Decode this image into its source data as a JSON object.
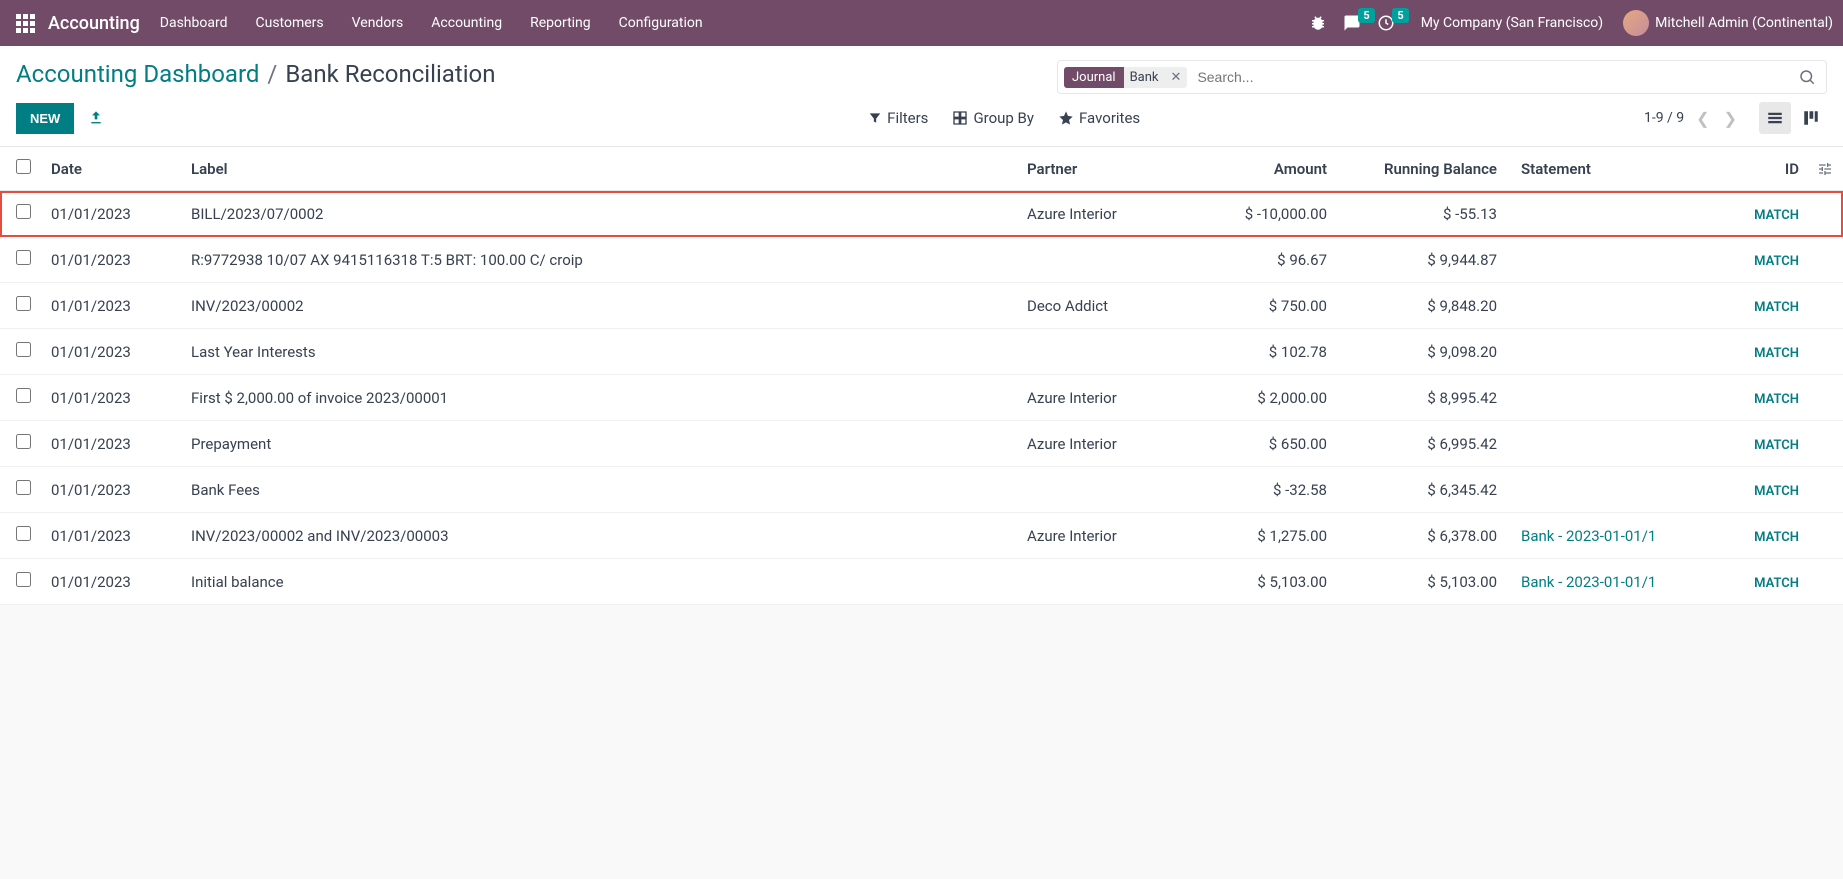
{
  "topbar": {
    "app_name": "Accounting",
    "nav": [
      "Dashboard",
      "Customers",
      "Vendors",
      "Accounting",
      "Reporting",
      "Configuration"
    ],
    "msg_badge": "5",
    "act_badge": "5",
    "company": "My Company (San Francisco)",
    "user": "Mitchell Admin (Continental)"
  },
  "breadcrumb": {
    "root": "Accounting Dashboard",
    "sep": "/",
    "current": "Bank Reconciliation"
  },
  "search": {
    "facet_label": "Journal",
    "facet_value": "Bank",
    "placeholder": "Search..."
  },
  "buttons": {
    "new": "NEW"
  },
  "filters": {
    "filters": "Filters",
    "groupby": "Group By",
    "favorites": "Favorites"
  },
  "pager": {
    "range": "1-9 / 9"
  },
  "columns": {
    "date": "Date",
    "label": "Label",
    "partner": "Partner",
    "amount": "Amount",
    "balance": "Running Balance",
    "statement": "Statement",
    "id": "ID"
  },
  "match_label": "MATCH",
  "rows": [
    {
      "date": "01/01/2023",
      "label": "BILL/2023/07/0002",
      "partner": "Azure Interior",
      "amount": "$ -10,000.00",
      "balance": "$ -55.13",
      "statement": "",
      "highlight": true
    },
    {
      "date": "01/01/2023",
      "label": "R:9772938 10/07 AX 9415116318 T:5 BRT: 100.00 C/ croip",
      "partner": "",
      "amount": "$ 96.67",
      "balance": "$ 9,944.87",
      "statement": ""
    },
    {
      "date": "01/01/2023",
      "label": "INV/2023/00002",
      "partner": "Deco Addict",
      "amount": "$ 750.00",
      "balance": "$ 9,848.20",
      "statement": ""
    },
    {
      "date": "01/01/2023",
      "label": "Last Year Interests",
      "partner": "",
      "amount": "$ 102.78",
      "balance": "$ 9,098.20",
      "statement": ""
    },
    {
      "date": "01/01/2023",
      "label": "First $ 2,000.00 of invoice 2023/00001",
      "partner": "Azure Interior",
      "amount": "$ 2,000.00",
      "balance": "$ 8,995.42",
      "statement": ""
    },
    {
      "date": "01/01/2023",
      "label": "Prepayment",
      "partner": "Azure Interior",
      "amount": "$ 650.00",
      "balance": "$ 6,995.42",
      "statement": ""
    },
    {
      "date": "01/01/2023",
      "label": "Bank Fees",
      "partner": "",
      "amount": "$ -32.58",
      "balance": "$ 6,345.42",
      "statement": ""
    },
    {
      "date": "01/01/2023",
      "label": "INV/2023/00002 and INV/2023/00003",
      "partner": "Azure Interior",
      "amount": "$ 1,275.00",
      "balance": "$ 6,378.00",
      "statement": "Bank - 2023-01-01/1"
    },
    {
      "date": "01/01/2023",
      "label": "Initial balance",
      "partner": "",
      "amount": "$ 5,103.00",
      "balance": "$ 5,103.00",
      "statement": "Bank - 2023-01-01/1"
    }
  ]
}
